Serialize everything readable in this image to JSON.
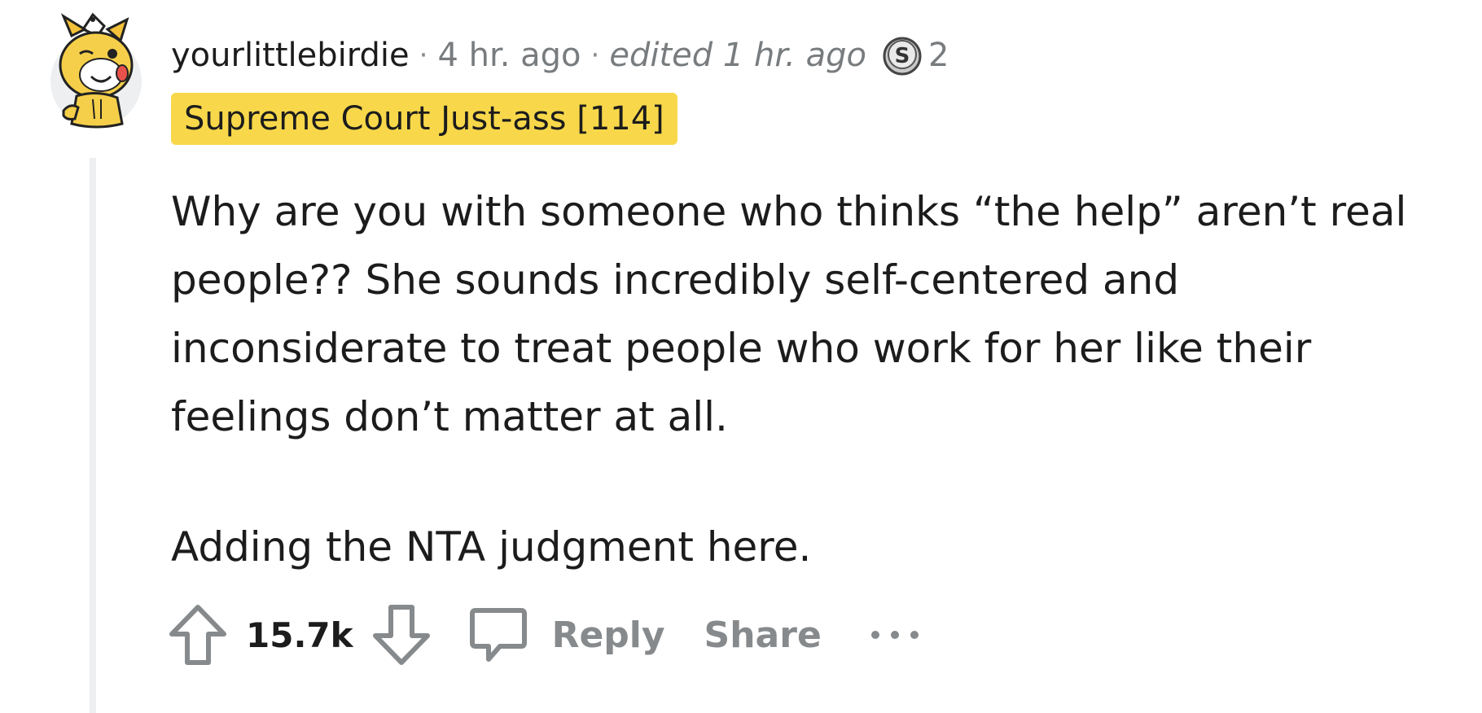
{
  "comment": {
    "author": "yourlittlebirdie",
    "separator": "·",
    "time_posted": "4 hr. ago",
    "edited_label": "edited 1 hr. ago",
    "award": {
      "icon": "silver-award-icon",
      "count": "2"
    },
    "flair": "Supreme Court Just-ass [114]",
    "flair_color": "#f8d84a",
    "body": {
      "paragraph_1": "Why are you with someone who thinks “the help” aren’t real people?? She sounds incredibly self-centered and inconsiderate to treat people who work for her like their feelings don’t matter at all.",
      "paragraph_2": "Adding the NTA judgment here."
    }
  },
  "actions": {
    "upvote_icon": "upvote-arrow-icon",
    "score": "15.7k",
    "downvote_icon": "downvote-arrow-icon",
    "reply_icon": "speech-bubble-icon",
    "reply_label": "Reply",
    "share_label": "Share",
    "more_icon": "ellipsis-icon"
  },
  "colors": {
    "text_primary": "#1c1c1c",
    "text_secondary": "#787c7e",
    "thread_line": "#edeff1",
    "action_grey": "#878a8c"
  }
}
